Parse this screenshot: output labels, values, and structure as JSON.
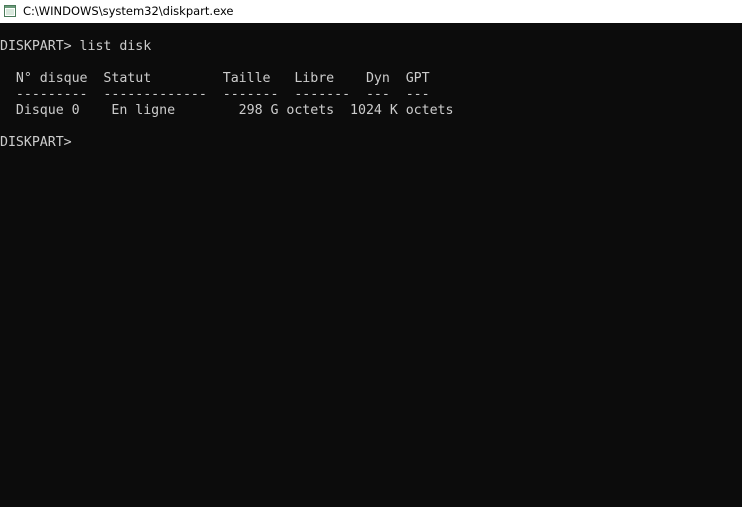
{
  "window": {
    "title": "C:\\WINDOWS\\system32\\diskpart.exe",
    "icon": "console-window-icon"
  },
  "console": {
    "lines": [
      "DISKPART> list disk",
      "",
      "  N° disque  Statut         Taille   Libre    Dyn  GPT",
      "  ---------  -------------  -------  -------  ---  ---",
      "  Disque 0    En ligne        298 G octets  1024 K octets",
      "",
      "DISKPART> "
    ]
  },
  "colors": {
    "console_bg": "#0c0c0c",
    "console_fg": "#cccccc",
    "titlebar_bg": "#ffffff"
  }
}
